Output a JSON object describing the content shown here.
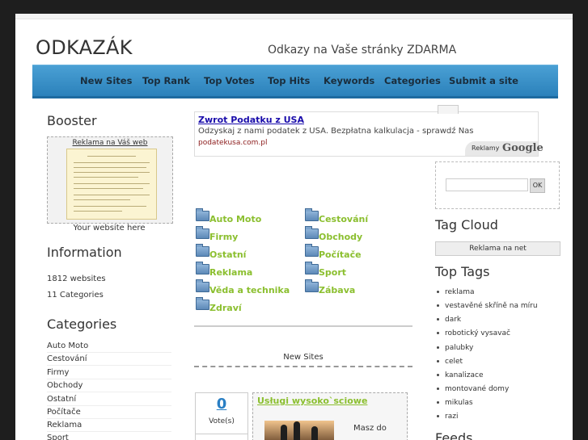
{
  "header": {
    "title": "ODKAZÁK",
    "tagline": "Odkazy na Vaše stránky ZDARMA"
  },
  "nav": {
    "items": [
      "New Sites",
      "Top Rank",
      "Top Votes",
      "Top Hits",
      "Keywords",
      "Categories",
      "Submit a site"
    ]
  },
  "left": {
    "booster_title": "Booster",
    "booster_link": "Reklama na Váš web",
    "booster_caption": "Your website here",
    "info_title": "Information",
    "websites": "1812 websites",
    "categories_count": "11 Categories",
    "categories_title": "Categories",
    "categories": [
      "Auto Moto",
      "Cestování",
      "Firmy",
      "Obchody",
      "Ostatní",
      "Počítače",
      "Reklama",
      "Sport"
    ]
  },
  "ad": {
    "title": "Zwrot Podatku z USA",
    "text": "Odzyskaj z nami podatek z USA. Bezpłatna kalkulacja - sprawdź Nas",
    "url": "podatekusa.com.pl",
    "badge_label": "Reklamy",
    "badge_brand": "Google"
  },
  "directory": {
    "col1": [
      "Auto Moto",
      "Firmy",
      "Ostatní",
      "Reklama",
      "Věda a technika",
      "Zdraví"
    ],
    "col2": [
      "Cestování",
      "Obchody",
      "Počítače",
      "Sport",
      "Zábava"
    ]
  },
  "new_sites": {
    "heading": "New Sites",
    "vote_count": "0",
    "vote_label": "Vote(s)",
    "entry_title": "Usługi wysoko`sciowe",
    "entry_text": "Masz do"
  },
  "right": {
    "search_button": "OK",
    "tag_cloud_title": "Tag Cloud",
    "tag_cloud_link": "Reklama na net",
    "top_tags_title": "Top Tags",
    "tags": [
      "reklama",
      "vestavěné skříně na míru",
      "dark",
      "robotický vysavač",
      "palubky",
      "celet",
      "kanalizace",
      "montované domy",
      "mikulas",
      "razi"
    ],
    "feeds_title": "Feeds"
  }
}
